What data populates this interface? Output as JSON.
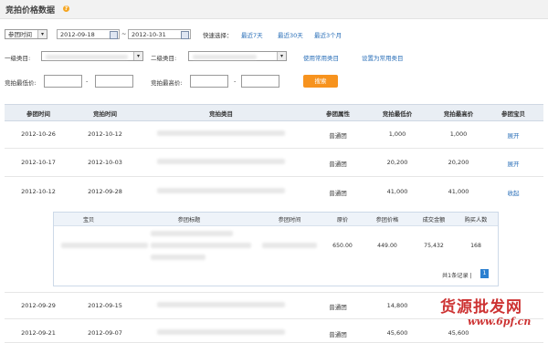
{
  "title": "竞拍价格数据",
  "filters": {
    "type_select": "参团时间",
    "date_from": "2012-09-18",
    "date_sep": "~",
    "date_to": "2012-10-31",
    "quick_label": "快速选择：",
    "quick_options": [
      "最近7天",
      "最近30天",
      "最近3个月"
    ],
    "cat1_label": "一级类目:",
    "cat2_label": "二级类目:",
    "use_common": "使用常用类目",
    "set_common": "设置为常用类目",
    "min_price_label": "竞拍最低价:",
    "max_price_label": "竞拍最高价:",
    "range_sep": "-",
    "search_label": "搜索"
  },
  "table": {
    "headers": [
      "参团时间",
      "竞拍时间",
      "竞拍类目",
      "参团属性",
      "竞拍最低价",
      "竞拍最高价",
      "参团宝贝"
    ],
    "rows": [
      {
        "join_time": "2012-10-26",
        "auction_time": "2012-10-12",
        "attr": "普通团",
        "min": "1,000",
        "max": "1,000",
        "action": "展开"
      },
      {
        "join_time": "2012-10-17",
        "auction_time": "2012-10-03",
        "attr": "普通团",
        "min": "20,200",
        "max": "20,200",
        "action": "展开"
      },
      {
        "join_time": "2012-10-12",
        "auction_time": "2012-09-28",
        "attr": "普通团",
        "min": "41,000",
        "max": "41,000",
        "action": "收起"
      },
      {
        "join_time": "2012-09-29",
        "auction_time": "2012-09-15",
        "attr": "普通团",
        "min": "14,800",
        "max": "",
        "action": ""
      },
      {
        "join_time": "2012-09-21",
        "auction_time": "2012-09-07",
        "attr": "普通团",
        "min": "45,600",
        "max": "45,600",
        "action": ""
      }
    ]
  },
  "detail": {
    "headers": [
      "宝贝",
      "参团标题",
      "参团时间",
      "原价",
      "参团价格",
      "成交金额",
      "购买人数"
    ],
    "row": {
      "orig": "650.00",
      "price": "449.00",
      "amount": "75,432",
      "buyers": "168"
    },
    "pager_text": "共1条记录",
    "pager_sep": "|",
    "page": "1"
  },
  "watermark": {
    "line1": "货源批发网",
    "line2": "www.6pf.cn"
  },
  "colors": {
    "accent": "#f7931e",
    "link": "#2a6fb8",
    "header_bg": "#e9eef4",
    "watermark": "#c81e1e"
  }
}
